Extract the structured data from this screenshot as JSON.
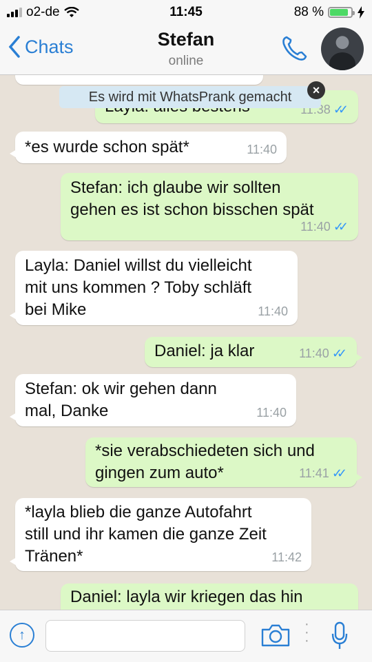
{
  "status_bar": {
    "carrier": "o2-de",
    "time": "11:45",
    "battery_percent": "88 %",
    "battery_level": 0.88
  },
  "header": {
    "back_label": "Chats",
    "contact_name": "Stefan",
    "contact_status": "online",
    "icons": [
      "chevron-left-icon",
      "phone-icon",
      "avatar"
    ]
  },
  "banner": {
    "text": "Es wird mit WhatsPrank gemacht"
  },
  "messages": [
    {
      "text": "Layla: alles bestens",
      "time": "11:38"
    },
    {
      "text": "*es wurde schon spät*",
      "time": "11:40"
    },
    {
      "text": "Stefan: ich glaube wir sollten\ngehen es ist schon bisschen spät",
      "time": "11:40"
    },
    {
      "text": "Layla: Daniel willst du vielleicht\nmit uns kommen ? Toby schläft\nbei Mike",
      "time": "11:40"
    },
    {
      "text": "Daniel: ja klar",
      "time": "11:40"
    },
    {
      "text": "Stefan: ok wir gehen dann\nmal, Danke",
      "time": "11:40"
    },
    {
      "text": "*sie verabschiedeten sich und\ngingen zum auto*",
      "time": "11:41"
    },
    {
      "text": "*layla blieb die ganze Autofahrt\nstill und ihr kamen die ganze Zeit\nTränen*",
      "time": "11:42"
    },
    {
      "text": "Daniel: layla wir kriegen das hin",
      "time": ""
    }
  ],
  "input_bar": {
    "placeholder": "",
    "icons": [
      "upload-icon",
      "camera-icon",
      "more-icon",
      "microphone-icon"
    ]
  },
  "colors": {
    "accent": "#2a7fd4",
    "outgoing_bubble": "#dcf8c6",
    "incoming_bubble": "#ffffff",
    "read_ticks": "#3497f9",
    "battery": "#4cd964"
  }
}
